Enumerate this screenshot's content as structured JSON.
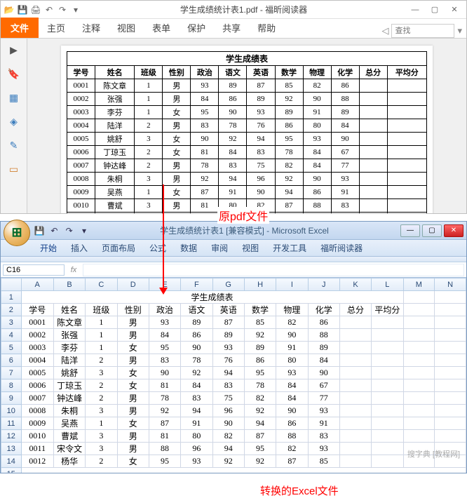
{
  "foxit": {
    "title": "学生成绩统计表1.pdf - 福昕阅读器",
    "tabs": {
      "file": "文件",
      "home": "主页",
      "comment": "注释",
      "view": "视图",
      "form": "表单",
      "protect": "保护",
      "share": "共享",
      "help": "帮助"
    },
    "search_ph": "查找"
  },
  "annot": {
    "pdf": "原pdf文件",
    "excel": "转换的Excel文件"
  },
  "excel": {
    "title": "学生成绩统计表1 [兼容模式] - Microsoft Excel",
    "tabs": {
      "start": "开始",
      "insert": "插入",
      "layout": "页面布局",
      "formula": "公式",
      "data": "数据",
      "review": "审阅",
      "view": "视图",
      "dev": "开发工具",
      "foxit": "福昕阅读器"
    },
    "namebox": "C16",
    "cols": [
      "A",
      "B",
      "C",
      "D",
      "E",
      "F",
      "G",
      "H",
      "I",
      "J",
      "K",
      "L",
      "M",
      "N"
    ]
  },
  "table": {
    "title": "学生成绩表",
    "headers": [
      "学号",
      "姓名",
      "班级",
      "性别",
      "政治",
      "语文",
      "英语",
      "数学",
      "物理",
      "化学",
      "总分",
      "平均分"
    ],
    "rows": [
      [
        "0001",
        "陈文章",
        "1",
        "男",
        "93",
        "89",
        "87",
        "85",
        "82",
        "86",
        "",
        ""
      ],
      [
        "0002",
        "张强",
        "1",
        "男",
        "84",
        "86",
        "89",
        "92",
        "90",
        "88",
        "",
        ""
      ],
      [
        "0003",
        "李芬",
        "1",
        "女",
        "95",
        "90",
        "93",
        "89",
        "91",
        "89",
        "",
        ""
      ],
      [
        "0004",
        "陆洋",
        "2",
        "男",
        "83",
        "78",
        "76",
        "86",
        "80",
        "84",
        "",
        ""
      ],
      [
        "0005",
        "姚舒",
        "3",
        "女",
        "90",
        "92",
        "94",
        "95",
        "93",
        "90",
        "",
        ""
      ],
      [
        "0006",
        "丁琼玉",
        "2",
        "女",
        "81",
        "84",
        "83",
        "78",
        "84",
        "67",
        "",
        ""
      ],
      [
        "0007",
        "钟达峰",
        "2",
        "男",
        "78",
        "83",
        "75",
        "82",
        "84",
        "77",
        "",
        ""
      ],
      [
        "0008",
        "朱桐",
        "3",
        "男",
        "92",
        "94",
        "96",
        "92",
        "90",
        "93",
        "",
        ""
      ],
      [
        "0009",
        "吴燕",
        "1",
        "女",
        "87",
        "91",
        "90",
        "94",
        "86",
        "91",
        "",
        ""
      ],
      [
        "0010",
        "曹斌",
        "3",
        "男",
        "81",
        "80",
        "82",
        "87",
        "88",
        "83",
        "",
        ""
      ],
      [
        "0011",
        "宋令文",
        "3",
        "男",
        "88",
        "96",
        "94",
        "95",
        "82",
        "93",
        "",
        ""
      ],
      [
        "0012",
        "杨华",
        "2",
        "女",
        "95",
        "93",
        "92",
        "92",
        "87",
        "85",
        "",
        ""
      ]
    ]
  },
  "chart_data": {
    "type": "table",
    "title": "学生成绩表",
    "columns": [
      "学号",
      "姓名",
      "班级",
      "性别",
      "政治",
      "语文",
      "英语",
      "数学",
      "物理",
      "化学",
      "总分",
      "平均分"
    ],
    "rows": [
      {
        "学号": "0001",
        "姓名": "陈文章",
        "班级": 1,
        "性别": "男",
        "政治": 93,
        "语文": 89,
        "英语": 87,
        "数学": 85,
        "物理": 82,
        "化学": 86
      },
      {
        "学号": "0002",
        "姓名": "张强",
        "班级": 1,
        "性别": "男",
        "政治": 84,
        "语文": 86,
        "英语": 89,
        "数学": 92,
        "物理": 90,
        "化学": 88
      },
      {
        "学号": "0003",
        "姓名": "李芬",
        "班级": 1,
        "性别": "女",
        "政治": 95,
        "语文": 90,
        "英语": 93,
        "数学": 89,
        "物理": 91,
        "化学": 89
      },
      {
        "学号": "0004",
        "姓名": "陆洋",
        "班级": 2,
        "性别": "男",
        "政治": 83,
        "语文": 78,
        "英语": 76,
        "数学": 86,
        "物理": 80,
        "化学": 84
      },
      {
        "学号": "0005",
        "姓名": "姚舒",
        "班级": 3,
        "性别": "女",
        "政治": 90,
        "语文": 92,
        "英语": 94,
        "数学": 95,
        "物理": 93,
        "化学": 90
      },
      {
        "学号": "0006",
        "姓名": "丁琼玉",
        "班级": 2,
        "性别": "女",
        "政治": 81,
        "语文": 84,
        "英语": 83,
        "数学": 78,
        "物理": 84,
        "化学": 67
      },
      {
        "学号": "0007",
        "姓名": "钟达峰",
        "班级": 2,
        "性别": "男",
        "政治": 78,
        "语文": 83,
        "英语": 75,
        "数学": 82,
        "物理": 84,
        "化学": 77
      },
      {
        "学号": "0008",
        "姓名": "朱桐",
        "班级": 3,
        "性别": "男",
        "政治": 92,
        "语文": 94,
        "英语": 96,
        "数学": 92,
        "物理": 90,
        "化学": 93
      },
      {
        "学号": "0009",
        "姓名": "吴燕",
        "班级": 1,
        "性别": "女",
        "政治": 87,
        "语文": 91,
        "英语": 90,
        "数学": 94,
        "物理": 86,
        "化学": 91
      },
      {
        "学号": "0010",
        "姓名": "曹斌",
        "班级": 3,
        "性别": "男",
        "政治": 81,
        "语文": 80,
        "英语": 82,
        "数学": 87,
        "物理": 88,
        "化学": 83
      },
      {
        "学号": "0011",
        "姓名": "宋令文",
        "班级": 3,
        "性别": "男",
        "政治": 88,
        "语文": 96,
        "英语": 94,
        "数学": 95,
        "物理": 82,
        "化学": 93
      },
      {
        "学号": "0012",
        "姓名": "杨华",
        "班级": 2,
        "性别": "女",
        "政治": 95,
        "语文": 93,
        "英语": 92,
        "数学": 92,
        "物理": 87,
        "化学": 85
      }
    ]
  },
  "watermark": "搜字典 [教程网]"
}
